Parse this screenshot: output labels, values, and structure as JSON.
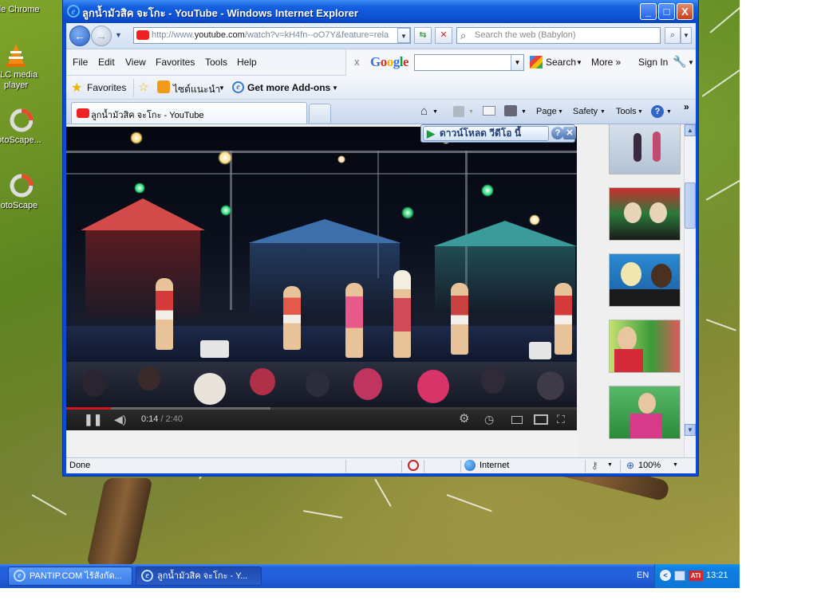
{
  "desktop": {
    "icons": [
      {
        "label": "ogle Chrome"
      },
      {
        "label": "VLC media player"
      },
      {
        "label": "otoScape..."
      },
      {
        "label": "otoScape"
      }
    ]
  },
  "window": {
    "title": "ลูกน้ำมัวสิค จะโกะ - YouTube - Windows Internet Explorer",
    "minimize": "_",
    "maximize": "□",
    "close": "X"
  },
  "address": {
    "url_prefix": "http://www.",
    "url_domain": "youtube.com",
    "url_rest": "/watch?v=kH4fn--oO7Y&feature=rela",
    "search_placeholder": "Search the web (Babylon)"
  },
  "menu": {
    "items": [
      "File",
      "Edit",
      "View",
      "Favorites",
      "Tools",
      "Help"
    ],
    "google": {
      "close": "x",
      "search_label": "Search",
      "more_label": "More »",
      "signin_label": "Sign In"
    }
  },
  "favorites_bar": {
    "favorites_label": "Favorites",
    "suggested_sites": "ไซต์แนะนำ",
    "addons": "Get more Add-ons"
  },
  "tabs": {
    "active_title": "ลูกน้ำมัวสิค จะโกะ - YouTube",
    "commands": {
      "page": "Page",
      "safety": "Safety",
      "tools": "Tools"
    }
  },
  "video": {
    "current_time": "0:14",
    "duration": "/ 2:40",
    "progress_fraction": 0.0875,
    "buffered_fraction": 0.4,
    "download_label": "ดาวน์โหลด วีดีโอ นี้"
  },
  "statusbar": {
    "status": "Done",
    "zone": "Internet",
    "zoom": "100%"
  },
  "taskbar": {
    "buttons": [
      {
        "label": "PANTIP.COM ไร้สังกัด..."
      },
      {
        "label": "ลูกน้ำมัวสิค จะโกะ - Y..."
      }
    ],
    "language": "EN",
    "clock": "13:21"
  },
  "colors": {
    "titlebar": "#0d52d6",
    "taskbar": "#245edb",
    "progress": "#cc181e"
  }
}
